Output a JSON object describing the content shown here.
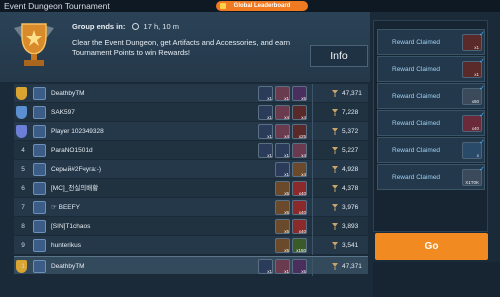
{
  "window": {
    "title": "Event Dungeon Tournament"
  },
  "global_leaderboard": {
    "label": "Global Leaderboard"
  },
  "header": {
    "group_ends_label": "Group ends in:",
    "time_left": "17 h, 10 m",
    "description": "Clear the Event Dungeon, get Artifacts and Accessories, and earn Tournament Points to win Rewards!",
    "info_label": "Info"
  },
  "leaderboard": {
    "rows": [
      {
        "rank": "",
        "name": "DeathbyTM",
        "items": [
          {
            "q": "x1"
          },
          {
            "q": "x1"
          },
          {
            "q": "x5"
          }
        ],
        "points": "47,371"
      },
      {
        "rank": "",
        "name": "SAK597",
        "items": [
          {
            "q": "x1"
          },
          {
            "q": "x4"
          },
          {
            "q": "x4"
          }
        ],
        "points": "7,228"
      },
      {
        "rank": "",
        "name": "Player 102349328",
        "items": [
          {
            "q": "x1"
          },
          {
            "q": "x4"
          },
          {
            "q": "x25"
          }
        ],
        "points": "5,372"
      },
      {
        "rank": "4",
        "name": "ParaNO1501d",
        "items": [
          {
            "q": "x1"
          },
          {
            "q": "x1"
          },
          {
            "q": "x4"
          }
        ],
        "points": "5,227"
      },
      {
        "rank": "5",
        "name": "Серый#2Fчуга:-)",
        "items": [
          {
            "q": "x1"
          },
          {
            "q": "x4"
          }
        ],
        "points": "4,928"
      },
      {
        "rank": "6",
        "name": "[MC]_천실의배황",
        "items": [
          {
            "q": "x5"
          },
          {
            "q": "x40"
          }
        ],
        "points": "4,378"
      },
      {
        "rank": "7",
        "name": "☞ BEEFY",
        "items": [
          {
            "q": "x5"
          },
          {
            "q": "x40"
          }
        ],
        "points": "3,976"
      },
      {
        "rank": "8",
        "name": "[SIN]T1chaos",
        "items": [
          {
            "q": "x5"
          },
          {
            "q": "x40"
          }
        ],
        "points": "3,893"
      },
      {
        "rank": "9",
        "name": "hunterikus",
        "items": [
          {
            "q": "x5"
          },
          {
            "q": "x150"
          }
        ],
        "points": "3,541"
      },
      {
        "rank": "1",
        "name": "DeathbyTM",
        "items": [
          {
            "q": "x1"
          },
          {
            "q": "x1"
          },
          {
            "q": "x5"
          }
        ],
        "points": "47,371"
      }
    ]
  },
  "rewards": {
    "items": [
      {
        "label": "Reward Claimed",
        "mult": "x1"
      },
      {
        "label": "Reward Claimed",
        "mult": "x1"
      },
      {
        "label": "Reward Claimed",
        "mult": "x50"
      },
      {
        "label": "Reward Claimed",
        "mult": "x40"
      },
      {
        "label": "Reward Claimed",
        "mult": "x"
      },
      {
        "label": "Reward Claimed",
        "mult": "X1T0K"
      }
    ]
  },
  "go_label": "Go",
  "colors": {
    "accent": "#f08a21",
    "panel": "#24384a",
    "claimed_text": "#9fd1f2"
  }
}
